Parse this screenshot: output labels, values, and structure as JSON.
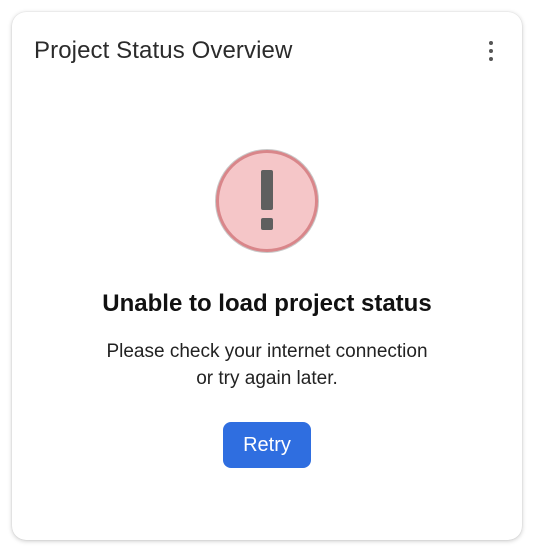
{
  "card": {
    "title": "Project Status Overview",
    "menu_icon": "more-vertical-icon"
  },
  "error": {
    "icon": "exclamation-icon",
    "heading": "Unable to load project status",
    "message_line1": "Please check your internet connection",
    "message_line2": "or try again later.",
    "retry_label": "Retry"
  },
  "colors": {
    "accent": "#2f6ee0",
    "error_fill": "#f5c6c8",
    "error_ring": "#d9868a"
  }
}
